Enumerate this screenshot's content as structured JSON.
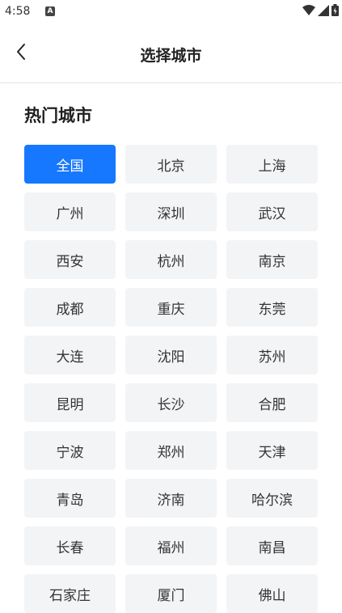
{
  "status_bar": {
    "time": "4:58",
    "notification_letter": "A"
  },
  "header": {
    "title": "选择城市"
  },
  "hot_cities": {
    "title": "热门城市",
    "selected_index": 0,
    "cities": [
      "全国",
      "北京",
      "上海",
      "广州",
      "深圳",
      "武汉",
      "西安",
      "杭州",
      "南京",
      "成都",
      "重庆",
      "东莞",
      "大连",
      "沈阳",
      "苏州",
      "昆明",
      "长沙",
      "合肥",
      "宁波",
      "郑州",
      "天津",
      "青岛",
      "济南",
      "哈尔滨",
      "长春",
      "福州",
      "南昌",
      "石家庄",
      "厦门",
      "佛山"
    ]
  },
  "colors": {
    "accent": "#1677ff",
    "cell_bg": "#f3f4f6"
  }
}
